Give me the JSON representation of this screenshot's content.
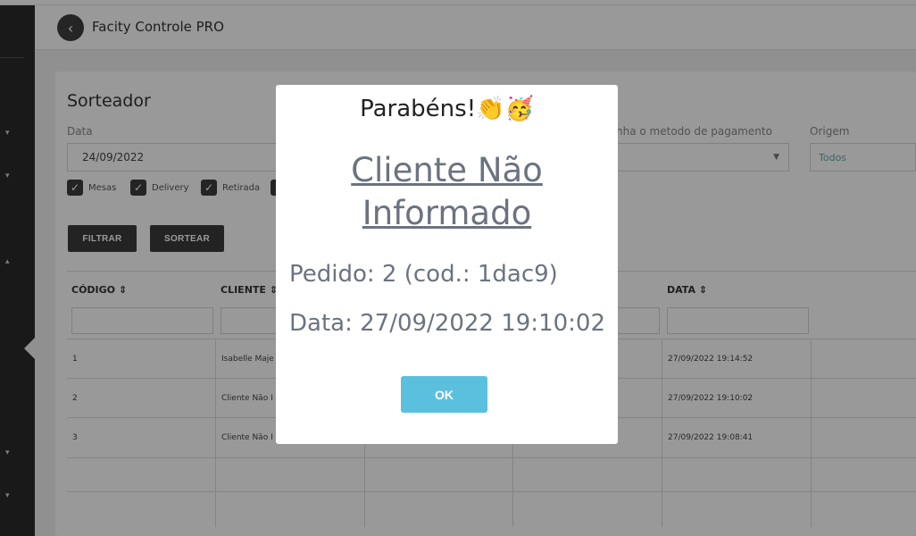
{
  "header": {
    "title": "Facity Controle PRO",
    "back_icon": "‹"
  },
  "page": {
    "title": "Sorteador"
  },
  "filters": {
    "date_label": "Data",
    "date_value": "24/09/2022",
    "payment_label": "nha o metodo de pagamento",
    "origin_label": "Origem",
    "origin_value": "Todos",
    "checkboxes": [
      {
        "label": "Mesas",
        "checked": true
      },
      {
        "label": "Delivery",
        "checked": true
      },
      {
        "label": "Retirada",
        "checked": true
      }
    ],
    "check_mark": "✓"
  },
  "buttons": {
    "filter": "FILTRAR",
    "draw": "SORTEAR"
  },
  "table": {
    "columns": [
      "CÓDIGO ⇕",
      "CLIENTE ⇕",
      "DATA ⇕"
    ],
    "rows": [
      {
        "code": "1",
        "client": "Isabelle Maje",
        "date": "27/09/2022 19:14:52"
      },
      {
        "code": "2",
        "client": "Cliente Não I",
        "date": "27/09/2022 19:10:02"
      },
      {
        "code": "3",
        "client": "Cliente Não I",
        "date": "27/09/2022 19:08:41"
      }
    ]
  },
  "modal": {
    "title": "Parabéns!👏🥳",
    "client": "Cliente Não Informado",
    "order_line": "Pedido: 2 (cod.: 1dac9)",
    "date_line": "Data: 27/09/2022 19:10:02",
    "ok_label": "OK"
  },
  "colors": {
    "accent": "#5bc0de",
    "dark": "#3b3b3b",
    "muted_text": "#6b7380"
  }
}
